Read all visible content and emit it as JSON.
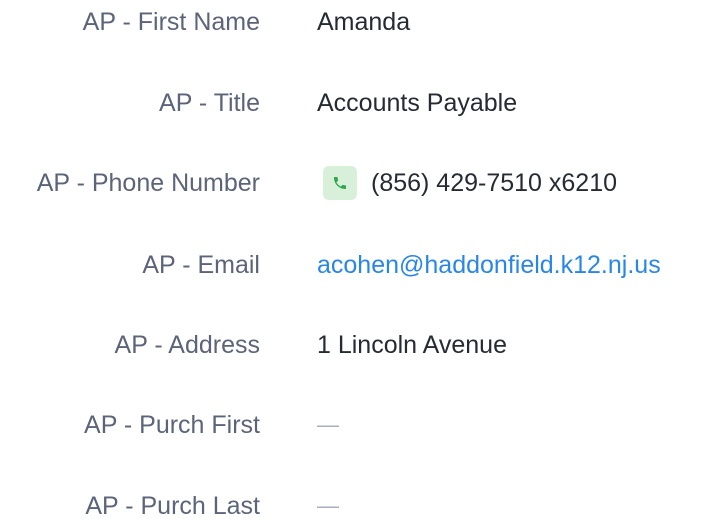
{
  "fields": [
    {
      "label": "AP - First Name",
      "value": "Amanda"
    },
    {
      "label": "AP - Title",
      "value": "Accounts Payable"
    },
    {
      "label": "AP - Phone Number",
      "value": "(856) 429-7510 x6210"
    },
    {
      "label": "AP - Email",
      "value": "acohen@haddonfield.k12.nj.us"
    },
    {
      "label": "AP - Address",
      "value": "1 Lincoln Avenue"
    },
    {
      "label": "AP - Purch First",
      "value": "—"
    },
    {
      "label": "AP - Purch Last",
      "value": "—"
    }
  ],
  "icons": {
    "phone": "phone-icon"
  },
  "colors": {
    "label": "#5b6478",
    "value": "#262a33",
    "link": "#2a86e6",
    "phone_bg": "#d8efd9",
    "phone_fg": "#2aa84a"
  }
}
